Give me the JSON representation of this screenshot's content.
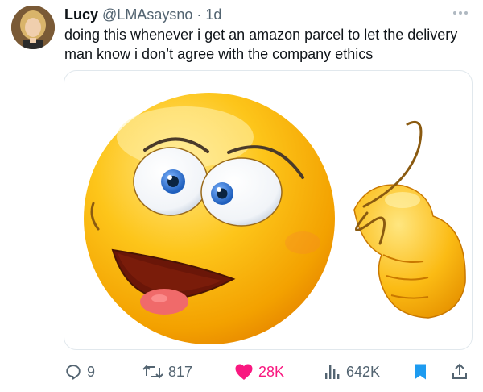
{
  "tweet": {
    "author_name": "Lucy",
    "handle": "@LMAsaysno",
    "separator": " · ",
    "time": "1d",
    "text": "doing this whenever i get an amazon parcel to let the delivery man know i don’t agree with the company ethics"
  },
  "media": {
    "image": "crazy-emoji-finger-circling-head"
  },
  "actions": {
    "replies": "9",
    "retweets": "817",
    "likes": "28K",
    "views": "642K"
  },
  "colors": {
    "like": "#f91880",
    "bookmark": "#1d9bf0",
    "secondary_text": "#536471",
    "emoji_face": "#f7b500"
  },
  "icons": {
    "reply": "reply-icon",
    "retweet": "retweet-icon",
    "like": "heart-icon",
    "views": "views-icon",
    "bookmark": "bookmark-icon",
    "share": "share-icon",
    "more": "more-icon"
  }
}
